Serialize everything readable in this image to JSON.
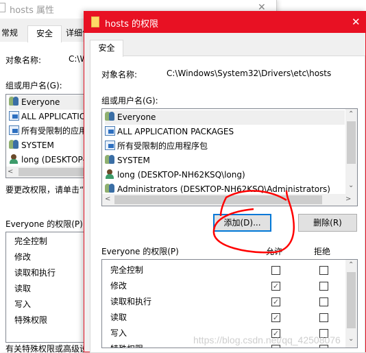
{
  "back_window": {
    "title": "hosts 属性",
    "close": "✕",
    "tabs": [
      "常规",
      "安全",
      "详细信"
    ],
    "object_label": "对象名称:",
    "object_value": "C:\\W",
    "group_label": "组或用户名(G):",
    "users": [
      "Everyone",
      "ALL APPLICATIONS",
      "所有受限制的应用",
      "SYSTEM",
      "long (DESKTOP-"
    ],
    "hint": "要更改权限，请单击“编",
    "perm_label": "Everyone 的权限(P)",
    "perms": [
      "完全控制",
      "修改",
      "读取和执行",
      "读取",
      "写入",
      "特殊权限"
    ],
    "footer": "有关特殊权限或高级设"
  },
  "dialog": {
    "title": "hosts 的权限",
    "close": "✕",
    "tab": "安全",
    "object_label": "对象名称:",
    "object_value": "C:\\Windows\\System32\\Drivers\\etc\\hosts",
    "group_label": "组或用户名(G):",
    "users": [
      {
        "name": "Everyone",
        "icon": "group-icon",
        "selected": true
      },
      {
        "name": "ALL APPLICATION PACKAGES",
        "icon": "package-icon"
      },
      {
        "name": "所有受限制的应用程序包",
        "icon": "package-icon"
      },
      {
        "name": "SYSTEM",
        "icon": "group-icon"
      },
      {
        "name": "long (DESKTOP-NH62KSQ\\long)",
        "icon": "user-icon"
      },
      {
        "name": "Administrators (DESKTOP-NH62KSQ\\Administrators)",
        "icon": "group-icon"
      }
    ],
    "add_button": "添加(D)...",
    "remove_button": "删除(R)",
    "perm_label": "Everyone 的权限(P)",
    "allow_header": "允许",
    "deny_header": "拒绝",
    "perms": [
      {
        "name": "完全控制",
        "allow": false,
        "deny": false
      },
      {
        "name": "修改",
        "allow": true,
        "deny": false
      },
      {
        "name": "读取和执行",
        "allow": true,
        "deny": false
      },
      {
        "name": "读取",
        "allow": true,
        "deny": false
      },
      {
        "name": "写入",
        "allow": true,
        "deny": false
      },
      {
        "name": "特殊权限",
        "allow": false,
        "deny": false
      }
    ]
  },
  "watermark": "https://blog.csdn.net/qq_42508076",
  "annotation_color": "#ff0000",
  "accent": "#e81123"
}
